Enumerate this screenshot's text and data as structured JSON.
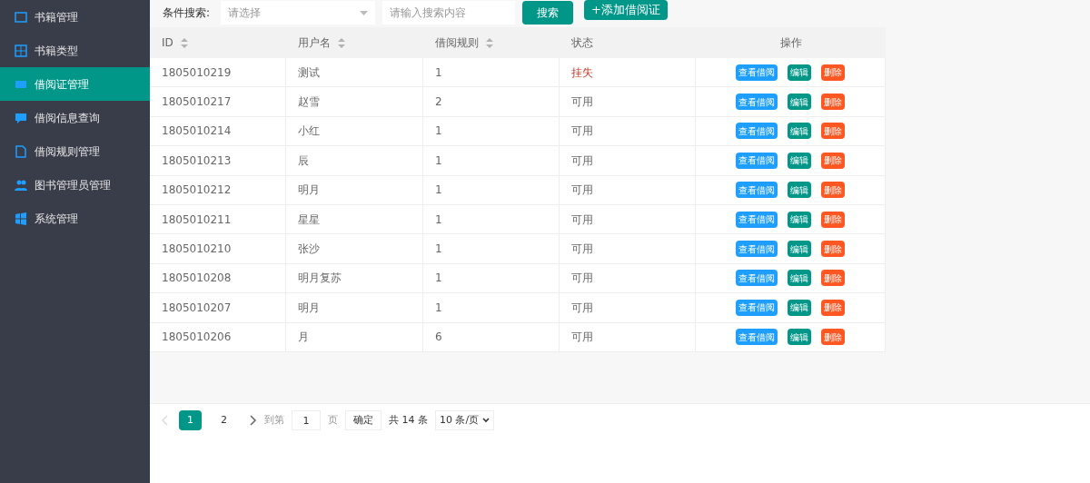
{
  "sidebar": {
    "items": [
      {
        "label": "书籍管理",
        "selected": false
      },
      {
        "label": "书籍类型",
        "selected": false
      },
      {
        "label": "借阅证管理",
        "selected": true
      },
      {
        "label": "借阅信息查询",
        "selected": false
      },
      {
        "label": "借阅规则管理",
        "selected": false
      },
      {
        "label": "图书管理员管理",
        "selected": false
      },
      {
        "label": "系统管理",
        "selected": false
      }
    ]
  },
  "search": {
    "label": "条件搜索:",
    "select_placeholder": "请选择",
    "placeholder": "请输入搜索内容",
    "search_button": "搜索",
    "add_button": "+添加借阅证"
  },
  "table": {
    "columns": [
      {
        "label": "ID",
        "sortable": true
      },
      {
        "label": "用户名",
        "sortable": true
      },
      {
        "label": "借阅规则",
        "sortable": true
      },
      {
        "label": "状态",
        "sortable": false
      },
      {
        "label": "操作",
        "sortable": false
      }
    ],
    "rows": [
      {
        "id": "1805010219",
        "user": "测试",
        "rule": "1",
        "status": "挂失",
        "lost": true,
        "actions": [
          {
            "label": "查看借阅",
            "kind": "view"
          },
          {
            "label": "编辑",
            "kind": "edit"
          },
          {
            "label": "删除",
            "kind": "delete"
          }
        ]
      },
      {
        "id": "1805010217",
        "user": "赵雪",
        "rule": "2",
        "status": "可用",
        "lost": false,
        "actions": [
          {
            "label": "查看借阅",
            "kind": "view"
          },
          {
            "label": "编辑",
            "kind": "edit"
          },
          {
            "label": "删除",
            "kind": "delete"
          }
        ]
      },
      {
        "id": "1805010214",
        "user": "小红",
        "rule": "1",
        "status": "可用",
        "lost": false,
        "actions": [
          {
            "label": "查看借阅",
            "kind": "view"
          },
          {
            "label": "编辑",
            "kind": "edit"
          },
          {
            "label": "删除",
            "kind": "delete"
          }
        ]
      },
      {
        "id": "1805010213",
        "user": "辰",
        "rule": "1",
        "status": "可用",
        "lost": false,
        "actions": [
          {
            "label": "查看借阅",
            "kind": "view"
          },
          {
            "label": "编辑",
            "kind": "edit"
          },
          {
            "label": "删除",
            "kind": "delete"
          }
        ]
      },
      {
        "id": "1805010212",
        "user": "明月",
        "rule": "1",
        "status": "可用",
        "lost": false,
        "actions": [
          {
            "label": "查看借阅",
            "kind": "view"
          },
          {
            "label": "编辑",
            "kind": "edit"
          },
          {
            "label": "删除",
            "kind": "delete"
          }
        ]
      },
      {
        "id": "1805010211",
        "user": "星星",
        "rule": "1",
        "status": "可用",
        "lost": false,
        "actions": [
          {
            "label": "查看借阅",
            "kind": "view"
          },
          {
            "label": "编辑",
            "kind": "edit"
          },
          {
            "label": "删除",
            "kind": "delete"
          }
        ]
      },
      {
        "id": "1805010210",
        "user": "张沙",
        "rule": "1",
        "status": "可用",
        "lost": false,
        "actions": [
          {
            "label": "查看借阅",
            "kind": "view"
          },
          {
            "label": "编辑",
            "kind": "edit"
          },
          {
            "label": "删除",
            "kind": "delete"
          }
        ]
      },
      {
        "id": "1805010208",
        "user": "明月复苏",
        "rule": "1",
        "status": "可用",
        "lost": false,
        "actions": [
          {
            "label": "查看借阅",
            "kind": "view"
          },
          {
            "label": "编辑",
            "kind": "edit"
          },
          {
            "label": "删除",
            "kind": "delete"
          }
        ]
      },
      {
        "id": "1805010207",
        "user": "明月",
        "rule": "1",
        "status": "可用",
        "lost": false,
        "actions": [
          {
            "label": "查看借阅",
            "kind": "view"
          },
          {
            "label": "编辑",
            "kind": "edit"
          },
          {
            "label": "删除",
            "kind": "delete"
          }
        ]
      },
      {
        "id": "1805010206",
        "user": "月",
        "rule": "6",
        "status": "可用",
        "lost": false,
        "actions": [
          {
            "label": "查看借阅",
            "kind": "view"
          },
          {
            "label": "编辑",
            "kind": "edit"
          },
          {
            "label": "删除",
            "kind": "delete"
          }
        ]
      }
    ]
  },
  "pagination": {
    "pages": [
      {
        "label": "1",
        "selected": true
      },
      {
        "label": "2",
        "selected": false
      }
    ],
    "prev_disabled": true,
    "goto_label": "到第",
    "goto_value": "1",
    "page_unit": "页",
    "confirm": "确定",
    "total": "共 14 条",
    "page_size": "10 条/页"
  }
}
